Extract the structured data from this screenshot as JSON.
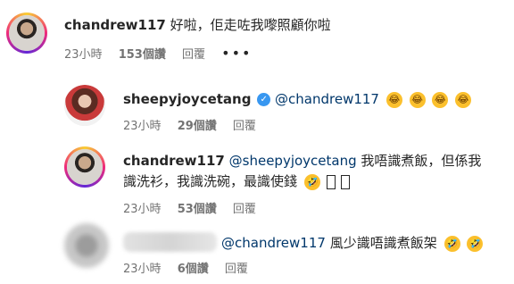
{
  "comments": [
    {
      "username": "chandrew117",
      "text": "好啦，佢走咗我嚟照顧你啦",
      "time": "23小時",
      "likes": "153個讚",
      "reply": "回覆",
      "more": "•••"
    },
    {
      "username": "sheepyjoycetang",
      "verified_icon": "✓",
      "mention": "@chandrew117",
      "time": "23小時",
      "likes": "29個讚",
      "reply": "回覆",
      "emoji": "😂"
    },
    {
      "username": "chandrew117",
      "mention": "@sheepyjoycetang",
      "text_line1": "我唔識煮飯，但係我",
      "text_line2": "識洗衫，我識洗碗，最識使錢",
      "time": "23小時",
      "likes": "53個讚",
      "reply": "回覆",
      "emoji": "🤣"
    },
    {
      "mention": "@chandrew117",
      "text": "風少識唔識煮飯架",
      "time": "23小時",
      "likes": "6個讚",
      "reply": "回覆",
      "emoji": "🤣"
    }
  ]
}
